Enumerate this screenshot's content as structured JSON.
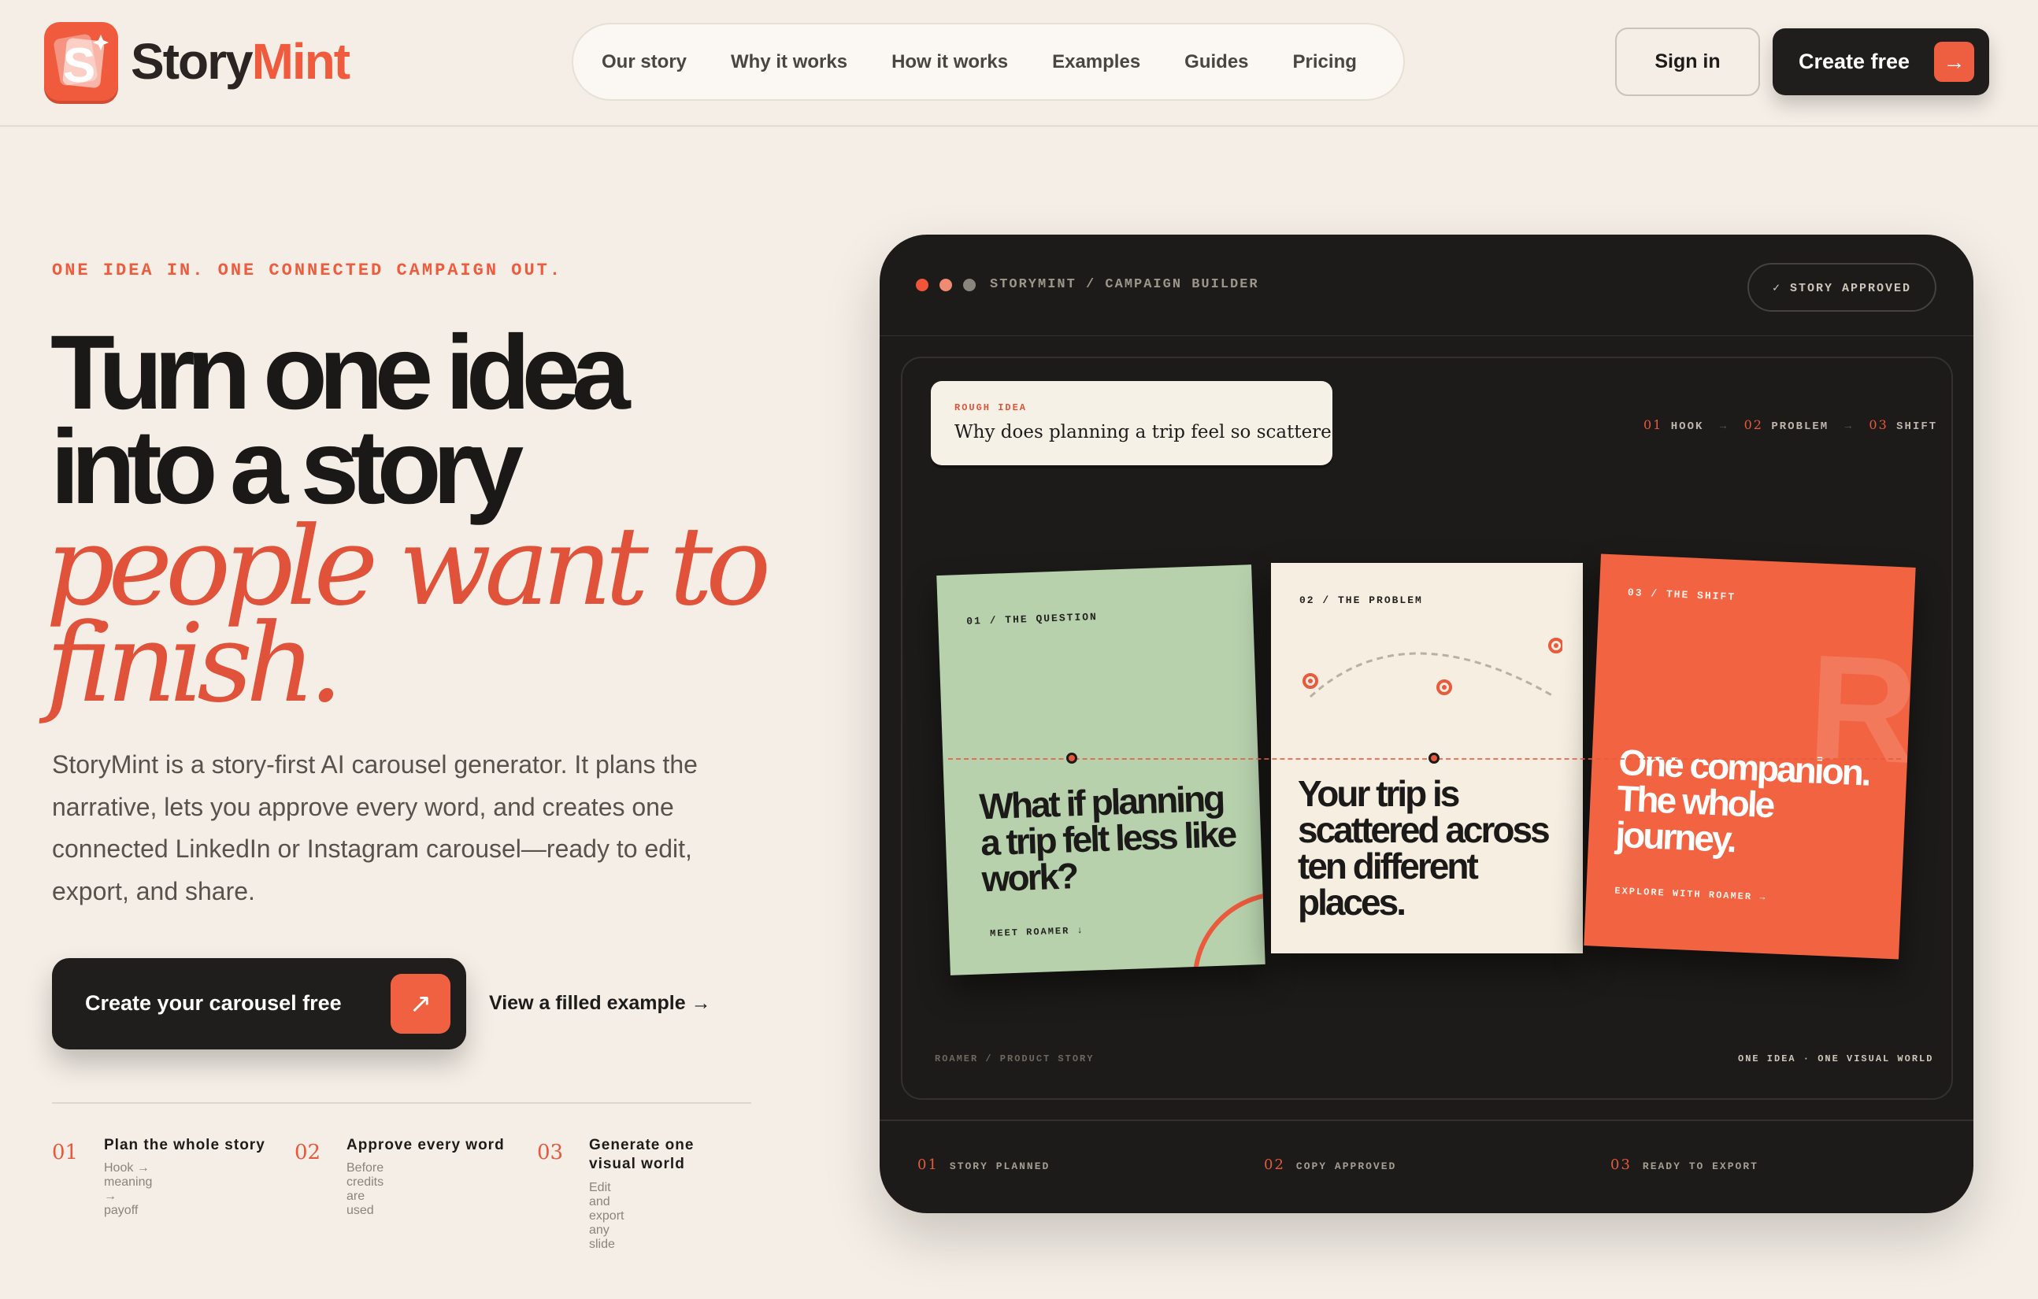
{
  "brand": {
    "name_a": "Story",
    "name_b": "Mint",
    "accent": "#f05b3e"
  },
  "nav": {
    "items": [
      "Our story",
      "Why it works",
      "How it works",
      "Examples",
      "Guides",
      "Pricing"
    ]
  },
  "header": {
    "signin": "Sign in",
    "create": "Create free"
  },
  "hero": {
    "eyebrow": "ONE IDEA IN. ONE CONNECTED CAMPAIGN OUT.",
    "title_1": "Turn one idea",
    "title_2": "into a story",
    "title_3": "people want to",
    "title_4": "finish.",
    "body": "StoryMint is a story-first AI carousel generator. It plans the narrative, lets you approve every word, and creates one connected LinkedIn or Instagram carousel—ready to edit, export, and share.",
    "cta": "Create your carousel free",
    "link": "View a filled example →"
  },
  "steps": [
    {
      "num": "01",
      "title": "Plan the whole story",
      "sub": "Hook → meaning → payoff"
    },
    {
      "num": "02",
      "title": "Approve every word",
      "sub": "Before credits are used"
    },
    {
      "num": "03",
      "title": "Generate one visual world",
      "sub": "Edit and export any slide"
    }
  ],
  "device": {
    "title": "STORYMINT / CAMPAIGN BUILDER",
    "badge": "✓  STORY APPROVED",
    "rough_label": "ROUGH IDEA",
    "rough_text": "Why does planning a trip feel so scattered?",
    "flow": [
      {
        "num": "01",
        "label": "HOOK"
      },
      {
        "num": "02",
        "label": "PROBLEM"
      },
      {
        "num": "03",
        "label": "SHIFT"
      }
    ],
    "cards": [
      {
        "label": "01 / THE QUESTION",
        "text": "What if planning a trip felt less like work?",
        "foot": "MEET ROAMER ↓",
        "color": "#b7d1ad"
      },
      {
        "label": "02 / THE PROBLEM",
        "text": "Your trip is scattered across ten different places.",
        "foot": "",
        "color": "#f6efe1"
      },
      {
        "label": "03 / THE SHIFT",
        "text": "One companion. The whole journey.",
        "foot": "EXPLORE WITH ROAMER →",
        "color": "#f26342",
        "watermark": "R"
      }
    ],
    "footer_left": "ROAMER / PRODUCT STORY",
    "footer_right": "ONE IDEA · ONE VISUAL WORLD",
    "status": [
      {
        "num": "01",
        "label": "STORY PLANNED"
      },
      {
        "num": "02",
        "label": "COPY APPROVED"
      },
      {
        "num": "03",
        "label": "READY TO EXPORT"
      }
    ]
  }
}
